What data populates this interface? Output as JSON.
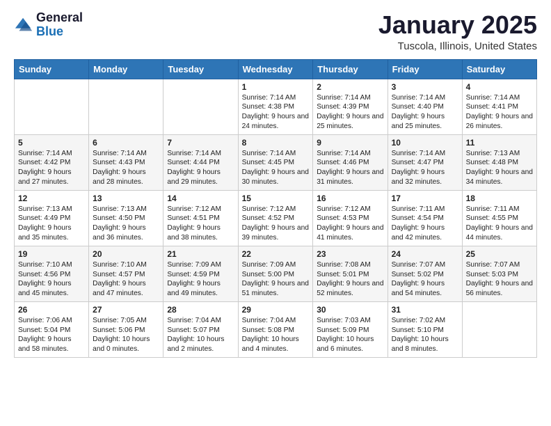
{
  "logo": {
    "general": "General",
    "blue": "Blue"
  },
  "title": "January 2025",
  "location": "Tuscola, Illinois, United States",
  "days_of_week": [
    "Sunday",
    "Monday",
    "Tuesday",
    "Wednesday",
    "Thursday",
    "Friday",
    "Saturday"
  ],
  "weeks": [
    [
      {
        "day": "",
        "sunrise": "",
        "sunset": "",
        "daylight": ""
      },
      {
        "day": "",
        "sunrise": "",
        "sunset": "",
        "daylight": ""
      },
      {
        "day": "",
        "sunrise": "",
        "sunset": "",
        "daylight": ""
      },
      {
        "day": "1",
        "sunrise": "Sunrise: 7:14 AM",
        "sunset": "Sunset: 4:38 PM",
        "daylight": "Daylight: 9 hours and 24 minutes."
      },
      {
        "day": "2",
        "sunrise": "Sunrise: 7:14 AM",
        "sunset": "Sunset: 4:39 PM",
        "daylight": "Daylight: 9 hours and 25 minutes."
      },
      {
        "day": "3",
        "sunrise": "Sunrise: 7:14 AM",
        "sunset": "Sunset: 4:40 PM",
        "daylight": "Daylight: 9 hours and 25 minutes."
      },
      {
        "day": "4",
        "sunrise": "Sunrise: 7:14 AM",
        "sunset": "Sunset: 4:41 PM",
        "daylight": "Daylight: 9 hours and 26 minutes."
      }
    ],
    [
      {
        "day": "5",
        "sunrise": "Sunrise: 7:14 AM",
        "sunset": "Sunset: 4:42 PM",
        "daylight": "Daylight: 9 hours and 27 minutes."
      },
      {
        "day": "6",
        "sunrise": "Sunrise: 7:14 AM",
        "sunset": "Sunset: 4:43 PM",
        "daylight": "Daylight: 9 hours and 28 minutes."
      },
      {
        "day": "7",
        "sunrise": "Sunrise: 7:14 AM",
        "sunset": "Sunset: 4:44 PM",
        "daylight": "Daylight: 9 hours and 29 minutes."
      },
      {
        "day": "8",
        "sunrise": "Sunrise: 7:14 AM",
        "sunset": "Sunset: 4:45 PM",
        "daylight": "Daylight: 9 hours and 30 minutes."
      },
      {
        "day": "9",
        "sunrise": "Sunrise: 7:14 AM",
        "sunset": "Sunset: 4:46 PM",
        "daylight": "Daylight: 9 hours and 31 minutes."
      },
      {
        "day": "10",
        "sunrise": "Sunrise: 7:14 AM",
        "sunset": "Sunset: 4:47 PM",
        "daylight": "Daylight: 9 hours and 32 minutes."
      },
      {
        "day": "11",
        "sunrise": "Sunrise: 7:13 AM",
        "sunset": "Sunset: 4:48 PM",
        "daylight": "Daylight: 9 hours and 34 minutes."
      }
    ],
    [
      {
        "day": "12",
        "sunrise": "Sunrise: 7:13 AM",
        "sunset": "Sunset: 4:49 PM",
        "daylight": "Daylight: 9 hours and 35 minutes."
      },
      {
        "day": "13",
        "sunrise": "Sunrise: 7:13 AM",
        "sunset": "Sunset: 4:50 PM",
        "daylight": "Daylight: 9 hours and 36 minutes."
      },
      {
        "day": "14",
        "sunrise": "Sunrise: 7:12 AM",
        "sunset": "Sunset: 4:51 PM",
        "daylight": "Daylight: 9 hours and 38 minutes."
      },
      {
        "day": "15",
        "sunrise": "Sunrise: 7:12 AM",
        "sunset": "Sunset: 4:52 PM",
        "daylight": "Daylight: 9 hours and 39 minutes."
      },
      {
        "day": "16",
        "sunrise": "Sunrise: 7:12 AM",
        "sunset": "Sunset: 4:53 PM",
        "daylight": "Daylight: 9 hours and 41 minutes."
      },
      {
        "day": "17",
        "sunrise": "Sunrise: 7:11 AM",
        "sunset": "Sunset: 4:54 PM",
        "daylight": "Daylight: 9 hours and 42 minutes."
      },
      {
        "day": "18",
        "sunrise": "Sunrise: 7:11 AM",
        "sunset": "Sunset: 4:55 PM",
        "daylight": "Daylight: 9 hours and 44 minutes."
      }
    ],
    [
      {
        "day": "19",
        "sunrise": "Sunrise: 7:10 AM",
        "sunset": "Sunset: 4:56 PM",
        "daylight": "Daylight: 9 hours and 45 minutes."
      },
      {
        "day": "20",
        "sunrise": "Sunrise: 7:10 AM",
        "sunset": "Sunset: 4:57 PM",
        "daylight": "Daylight: 9 hours and 47 minutes."
      },
      {
        "day": "21",
        "sunrise": "Sunrise: 7:09 AM",
        "sunset": "Sunset: 4:59 PM",
        "daylight": "Daylight: 9 hours and 49 minutes."
      },
      {
        "day": "22",
        "sunrise": "Sunrise: 7:09 AM",
        "sunset": "Sunset: 5:00 PM",
        "daylight": "Daylight: 9 hours and 51 minutes."
      },
      {
        "day": "23",
        "sunrise": "Sunrise: 7:08 AM",
        "sunset": "Sunset: 5:01 PM",
        "daylight": "Daylight: 9 hours and 52 minutes."
      },
      {
        "day": "24",
        "sunrise": "Sunrise: 7:07 AM",
        "sunset": "Sunset: 5:02 PM",
        "daylight": "Daylight: 9 hours and 54 minutes."
      },
      {
        "day": "25",
        "sunrise": "Sunrise: 7:07 AM",
        "sunset": "Sunset: 5:03 PM",
        "daylight": "Daylight: 9 hours and 56 minutes."
      }
    ],
    [
      {
        "day": "26",
        "sunrise": "Sunrise: 7:06 AM",
        "sunset": "Sunset: 5:04 PM",
        "daylight": "Daylight: 9 hours and 58 minutes."
      },
      {
        "day": "27",
        "sunrise": "Sunrise: 7:05 AM",
        "sunset": "Sunset: 5:06 PM",
        "daylight": "Daylight: 10 hours and 0 minutes."
      },
      {
        "day": "28",
        "sunrise": "Sunrise: 7:04 AM",
        "sunset": "Sunset: 5:07 PM",
        "daylight": "Daylight: 10 hours and 2 minutes."
      },
      {
        "day": "29",
        "sunrise": "Sunrise: 7:04 AM",
        "sunset": "Sunset: 5:08 PM",
        "daylight": "Daylight: 10 hours and 4 minutes."
      },
      {
        "day": "30",
        "sunrise": "Sunrise: 7:03 AM",
        "sunset": "Sunset: 5:09 PM",
        "daylight": "Daylight: 10 hours and 6 minutes."
      },
      {
        "day": "31",
        "sunrise": "Sunrise: 7:02 AM",
        "sunset": "Sunset: 5:10 PM",
        "daylight": "Daylight: 10 hours and 8 minutes."
      },
      {
        "day": "",
        "sunrise": "",
        "sunset": "",
        "daylight": ""
      }
    ]
  ]
}
